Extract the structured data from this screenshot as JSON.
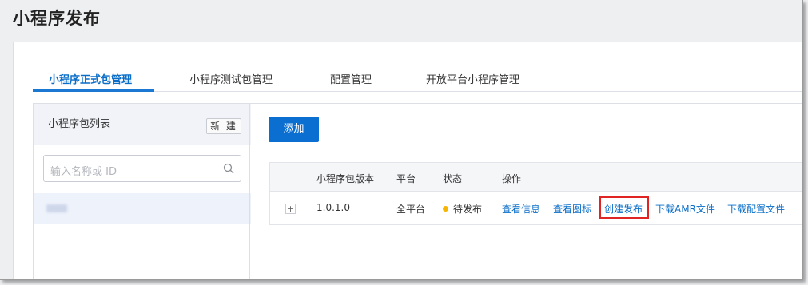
{
  "page": {
    "title": "小程序发布"
  },
  "tabs": [
    {
      "label": "小程序正式包管理",
      "active": true
    },
    {
      "label": "小程序测试包管理",
      "active": false
    },
    {
      "label": "配置管理",
      "active": false
    },
    {
      "label": "开放平台小程序管理",
      "active": false
    }
  ],
  "left_panel": {
    "title": "小程序包列表",
    "new_button": "新 建",
    "search": {
      "placeholder": "输入名称或 ID",
      "icon": "search-icon"
    }
  },
  "main": {
    "add_button": "添加",
    "table": {
      "columns": [
        "小程序包版本",
        "平台",
        "状态",
        "操作"
      ],
      "rows": [
        {
          "expand": "+",
          "version": "1.0.1.0",
          "platform": "全平台",
          "status": "待发布",
          "status_color": "#f7b500",
          "actions": [
            "查看信息",
            "查看图标",
            "创建发布",
            "下载AMR文件",
            "下载配置文件"
          ]
        }
      ]
    }
  },
  "colors": {
    "accent": "#0b6fd1",
    "highlight": "#e02424"
  }
}
